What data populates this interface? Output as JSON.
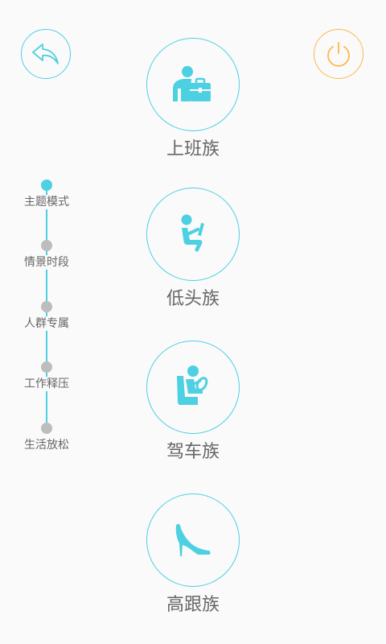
{
  "colors": {
    "accent": "#4dd0e1",
    "power": "#ffb74d",
    "dot_inactive": "#bdbdbd"
  },
  "header": {
    "back_icon": "back-arrow-icon",
    "power_icon": "power-icon"
  },
  "timeline": {
    "items": [
      {
        "label": "主题模式",
        "active": true
      },
      {
        "label": "情景时段",
        "active": false
      },
      {
        "label": "人群专属",
        "active": false
      },
      {
        "label": "工作释压",
        "active": false
      },
      {
        "label": "生活放松",
        "active": false
      }
    ]
  },
  "categories": [
    {
      "label": "上班族",
      "icon": "office-worker-icon"
    },
    {
      "label": "低头族",
      "icon": "phone-user-icon"
    },
    {
      "label": "驾车族",
      "icon": "driver-icon"
    },
    {
      "label": "高跟族",
      "icon": "high-heel-icon"
    }
  ]
}
